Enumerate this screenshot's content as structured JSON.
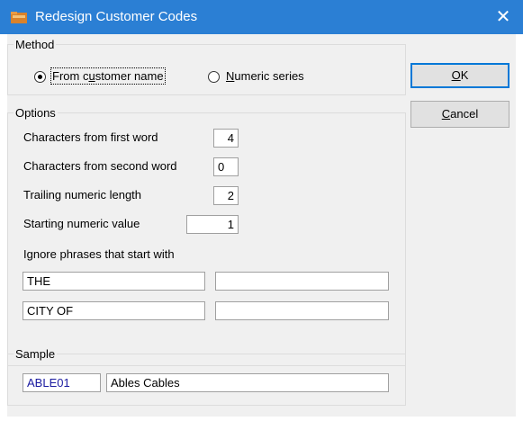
{
  "window": {
    "title": "Redesign Customer Codes"
  },
  "method": {
    "legend": "Method",
    "option1_pre": "From c",
    "option1_u": "u",
    "option1_post": "stomer name",
    "option2_u": "N",
    "option2_post": "umeric series",
    "selected": "From customer name"
  },
  "options": {
    "legend": "Options",
    "first_word_label": "Characters from first word",
    "first_word_value": "4",
    "second_word_label": "Characters from second word",
    "second_word_value": "0",
    "trailing_label": "Trailing numeric length",
    "trailing_value": "2",
    "starting_label": "Starting numeric value",
    "starting_value": "1",
    "ignore_label": "Ignore phrases that start with",
    "ignore_phrases": [
      "THE",
      "",
      "CITY OF",
      ""
    ]
  },
  "sample": {
    "legend": "Sample",
    "code": "ABLE01",
    "name": "Ables Cables",
    "code_color": "#1a1aa0"
  },
  "buttons": {
    "ok_u": "O",
    "ok_rest": "K",
    "cancel_u": "C",
    "cancel_rest": "ancel"
  },
  "colors": {
    "titlebar": "#2b7fd4",
    "accent": "#0078d7"
  },
  "icons": {
    "app": "folder-icon",
    "close": "close-icon"
  }
}
